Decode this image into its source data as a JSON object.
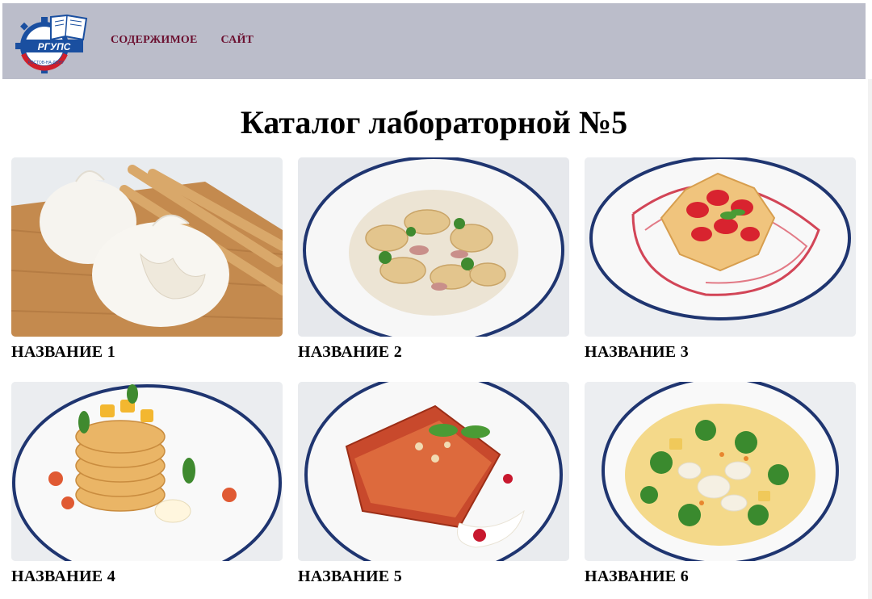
{
  "header": {
    "logo_text": "РГУПС",
    "logo_subtext": "РОСТОВ-НА-ДОНУ",
    "nav": [
      {
        "label": "СОДЕРЖИМОЕ"
      },
      {
        "label": "САЙТ"
      }
    ]
  },
  "page_title": "Каталог лабораторной №5",
  "catalog": [
    {
      "name": "НАЗВАНИЕ 1",
      "image": "burrata-cheese-with-breadsticks"
    },
    {
      "name": "НАЗВАНИЕ 2",
      "image": "pasta-dumplings-cream-sauce"
    },
    {
      "name": "НАЗВАНИЕ 3",
      "image": "strawberry-dessert-basket"
    },
    {
      "name": "НАЗВАНИЕ 4",
      "image": "pancakes-with-fruit"
    },
    {
      "name": "НАЗВАНИЕ 5",
      "image": "lasagna-with-basil"
    },
    {
      "name": "НАЗВАНИЕ 6",
      "image": "vegetable-chicken-soup"
    }
  ],
  "colors": {
    "header_bg": "#bbbdca",
    "nav_text": "#6b1030",
    "plate_rim": "#1f3570",
    "logo_blue": "#1a4fa0",
    "logo_red": "#d11f2b"
  }
}
